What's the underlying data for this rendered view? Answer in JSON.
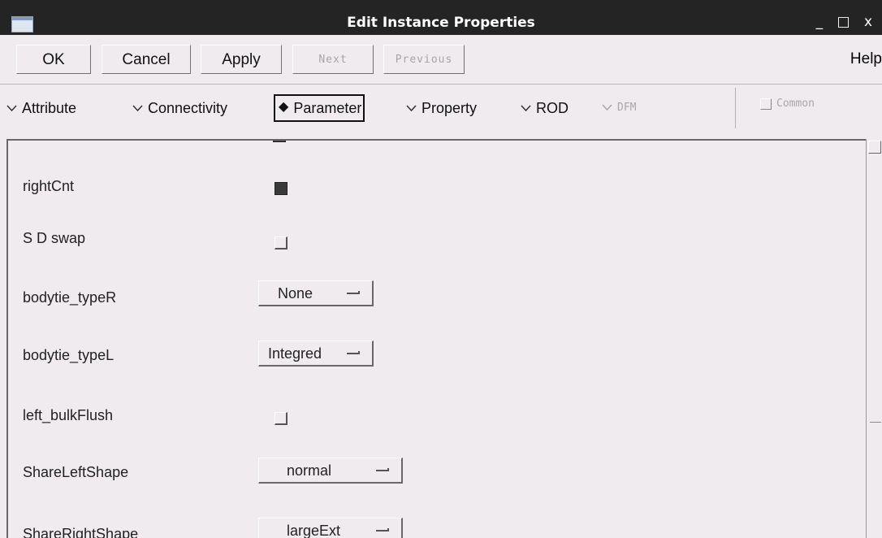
{
  "window": {
    "title": "Edit Instance Properties",
    "minimize": "_",
    "maximize": "□",
    "close": "x"
  },
  "toolbar": {
    "ok": "OK",
    "cancel": "Cancel",
    "apply": "Apply",
    "next": "Next",
    "previous": "Previous",
    "help": "Help"
  },
  "tabs": {
    "attribute": "Attribute",
    "connectivity": "Connectivity",
    "parameter": "Parameter",
    "property": "Property",
    "rod": "ROD",
    "dfm": "DFM",
    "selected": "parameter"
  },
  "common": {
    "label": "Common",
    "checked": false
  },
  "params": {
    "rightCnt": {
      "label": "rightCnt",
      "checked": true
    },
    "sdSwap": {
      "label": "S D swap",
      "checked": false
    },
    "bodytieTypeR": {
      "label": "bodytie_typeR",
      "value": "None"
    },
    "bodytieTypeL": {
      "label": "bodytie_typeL",
      "value": "Integred"
    },
    "leftBulkFlush": {
      "label": "left_bulkFlush",
      "checked": false
    },
    "shareLeftShape": {
      "label": "ShareLeftShape",
      "value": "normal"
    },
    "shareRightShape": {
      "label": "ShareRightShape",
      "value": "largeExt"
    }
  },
  "colors": {
    "titlebar": "#242424",
    "background": "#efebef",
    "disabled": "#aaa6aa"
  }
}
